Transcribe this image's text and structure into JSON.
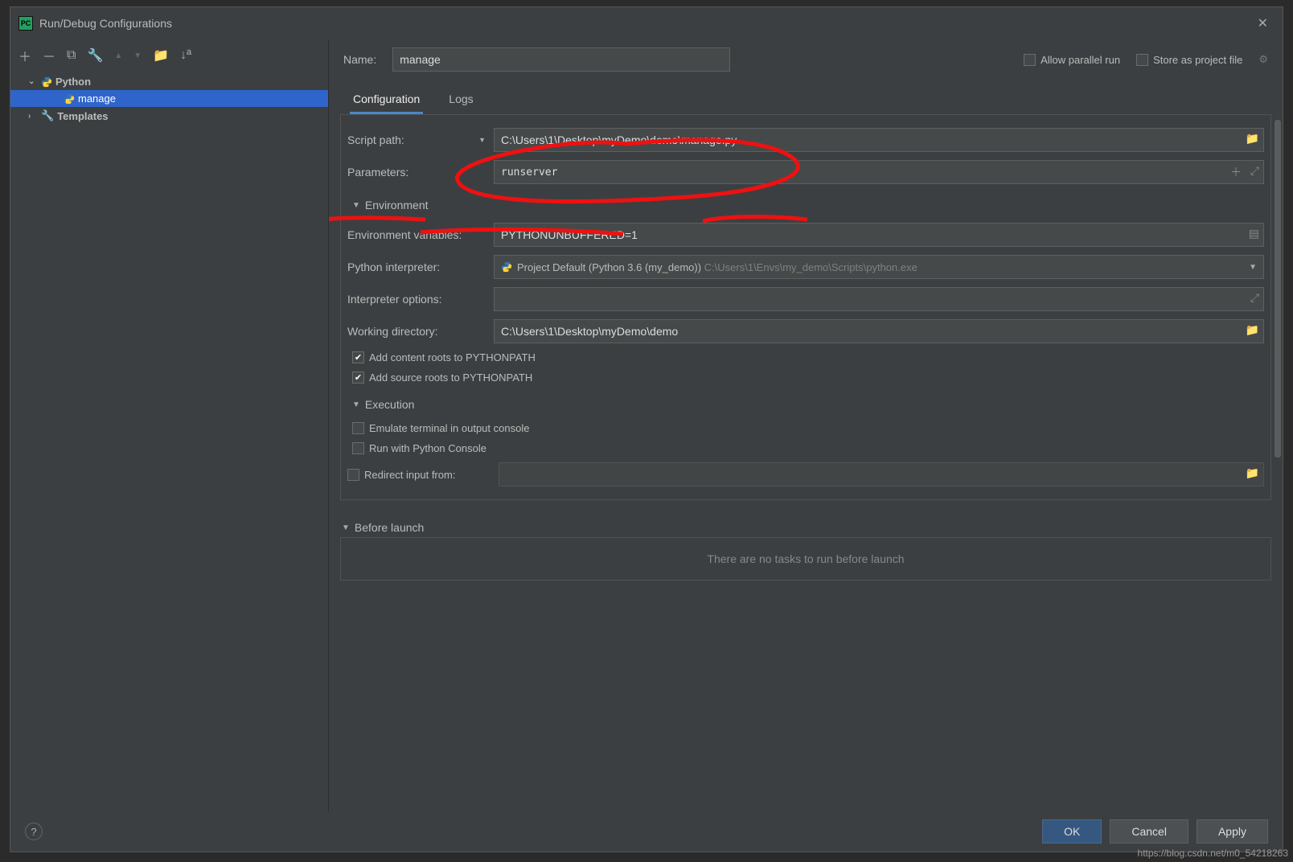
{
  "window": {
    "title": "Run/Debug Configurations"
  },
  "toolbar": {
    "add": "＋",
    "remove": "－",
    "copy": "⧉",
    "edit": "🔧",
    "up": "▲",
    "down": "▼",
    "folder": "📁",
    "sort": "↓ª"
  },
  "tree": {
    "python": "Python",
    "manage": "manage",
    "templates": "Templates"
  },
  "top": {
    "name_label": "Name:",
    "name_value": "manage",
    "allow_parallel": "Allow parallel run",
    "store_as_project": "Store as project file"
  },
  "tabs": {
    "configuration": "Configuration",
    "logs": "Logs"
  },
  "form": {
    "script_path_label": "Script path:",
    "script_path_value": "C:\\Users\\1\\Desktop\\myDemo\\demo\\manage.py",
    "parameters_label": "Parameters:",
    "parameters_value": "runserver",
    "env_header": "Environment",
    "env_vars_label": "Environment variables:",
    "env_vars_value": "PYTHONUNBUFFERED=1",
    "interpreter_label": "Python interpreter:",
    "interpreter_value": "Project Default (Python 3.6 (my_demo))",
    "interpreter_path": "C:\\Users\\1\\Envs\\my_demo\\Scripts\\python.exe",
    "interp_opts_label": "Interpreter options:",
    "interp_opts_value": "",
    "workdir_label": "Working directory:",
    "workdir_value": "C:\\Users\\1\\Desktop\\myDemo\\demo",
    "add_content_roots": "Add content roots to PYTHONPATH",
    "add_source_roots": "Add source roots to PYTHONPATH",
    "exec_header": "Execution",
    "emulate_terminal": "Emulate terminal in output console",
    "run_python_console": "Run with Python Console",
    "redirect_input": "Redirect input from:",
    "redirect_value": ""
  },
  "before_launch": {
    "header": "Before launch",
    "empty": "There are no tasks to run before launch"
  },
  "footer": {
    "ok": "OK",
    "cancel": "Cancel",
    "apply": "Apply"
  },
  "watermark": "https://blog.csdn.net/m0_54218263"
}
